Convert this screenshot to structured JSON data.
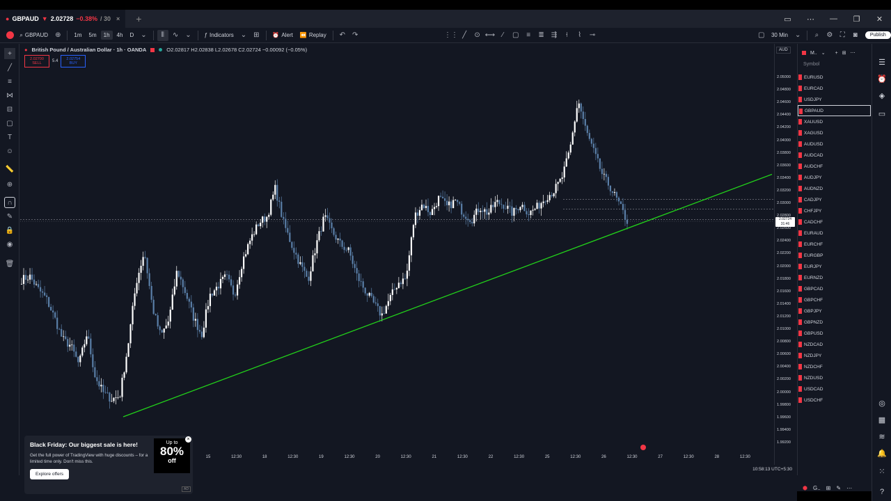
{
  "titlebar": {
    "symbol": "GBPAUD",
    "price": "2.02728",
    "change": "−0.38%",
    "trail": "/ 30",
    "plus": "+"
  },
  "toolbar": {
    "symbol": "GBPAUD",
    "intervals": [
      "1m",
      "5m",
      "1h",
      "4h",
      "D"
    ],
    "indicators": "Indicators",
    "alert": "Alert",
    "replay": "Replay",
    "timeframe": "30 Min",
    "publish": "Publish"
  },
  "legend": {
    "title": "British Pound / Australian Dollar · 1h · OANDA",
    "ohlc": "O2.02817 H2.02838 L2.02678 C2.02724 −0.00092 (−0.05%)",
    "sell_price": "2.02700",
    "sell": "SELL",
    "spread": "5.4",
    "buy_price": "2.02754",
    "buy": "BUY"
  },
  "price_axis": {
    "currency": "AUD",
    "labels": [
      "2.05000",
      "2.04800",
      "2.04600",
      "2.04400",
      "2.04200",
      "2.04000",
      "2.03800",
      "2.03600",
      "2.03400",
      "2.03200",
      "2.03000",
      "2.02800",
      "2.02600",
      "2.02400",
      "2.02200",
      "2.02000",
      "2.01800",
      "2.01600",
      "2.01400",
      "2.01200",
      "2.01000",
      "2.00800",
      "2.00600",
      "2.00400",
      "2.00200",
      "2.00000",
      "1.99800",
      "1.99600",
      "1.99400",
      "1.99200"
    ],
    "current": "2.02724",
    "countdown": "31:46"
  },
  "time_axis": {
    "labels": [
      "15",
      "12:30",
      "18",
      "12:30",
      "19",
      "12:30",
      "20",
      "12:30",
      "21",
      "12:30",
      "22",
      "12:30",
      "25",
      "12:30",
      "26",
      "12:30",
      "27",
      "12:30",
      "28",
      "12:30"
    ]
  },
  "status": {
    "clock": "10:58:13 UTC+5:30"
  },
  "promo": {
    "heading": "Black Friday: Our biggest sale is here!",
    "body": "Get the full power of TradingView with huge discounts – for a limited time only. Don't miss this.",
    "button": "Explore offers",
    "img_top": "Up to",
    "img_pct": "80%",
    "img_off": "off",
    "ad": "AD"
  },
  "watchlist": {
    "header": "M..",
    "column": "Symbol",
    "items": [
      "EURUSD",
      "EURCAD",
      "USDJPY",
      "GBPAUD",
      "XAUUSD",
      "XAGUSD",
      "AUDUSD",
      "AUDCAD",
      "AUDCHF",
      "AUDJPY",
      "AUDNZD",
      "CADJPY",
      "CHFJPY",
      "CADCHF",
      "EURAUD",
      "EURCHF",
      "EURGBP",
      "EURJPY",
      "EURNZD",
      "GBPCAD",
      "GBPCHF",
      "GBPJPY",
      "GBPNZD",
      "GBPUSD",
      "NZDCAD",
      "NZDJPY",
      "NZDCHF",
      "NZDUSD",
      "USDCAD",
      "USDCHF"
    ],
    "selected": "GBPAUD"
  },
  "bottom": {
    "label": "G.."
  },
  "colors": {
    "trendline": "#22d11a",
    "up": "#ffffff",
    "down": "#5a7fa8",
    "bg": "#131722"
  },
  "chart_data": {
    "type": "candlestick",
    "title": "British Pound / Australian Dollar · 1h · OANDA",
    "ylim": [
      1.991,
      2.0515
    ],
    "close_path": [
      2.018,
      2.0185,
      2.0165,
      2.015,
      2.012,
      2.0085,
      2.0075,
      2.0045,
      2.0095,
      2.0025,
      2.0,
      1.999,
      1.9995,
      2.0075,
      2.0175,
      2.0225,
      2.0135,
      2.009,
      2.0115,
      2.0195,
      2.016,
      2.012,
      2.0092,
      2.0155,
      2.017,
      2.0185,
      2.0155,
      2.021,
      2.0245,
      2.027,
      2.028,
      2.0325,
      2.027,
      2.0235,
      2.0205,
      2.018,
      2.0235,
      2.028,
      2.0255,
      2.0235,
      2.0225,
      2.0185,
      2.0162,
      2.0142,
      2.0123,
      2.015,
      2.0175,
      2.0182,
      2.028,
      2.03,
      2.0285,
      2.031,
      2.0295,
      2.0305,
      2.0285,
      2.0275,
      2.0295,
      2.0285,
      2.0303,
      2.0298,
      2.0285,
      2.03,
      2.0285,
      2.0295,
      2.031,
      2.032,
      2.034,
      2.0385,
      2.0465,
      2.0415,
      2.038,
      2.0345,
      2.0325,
      2.03,
      2.0272
    ],
    "trendline": {
      "from": {
        "x": "1h bar ~14",
        "y": 1.9962
      },
      "to": {
        "x": "1h bar ~ Nov 27 03:00",
        "y": 2.0347
      }
    },
    "hlines": [
      2.0307,
      2.0292,
      2.0275
    ],
    "current_price": 2.02724
  }
}
